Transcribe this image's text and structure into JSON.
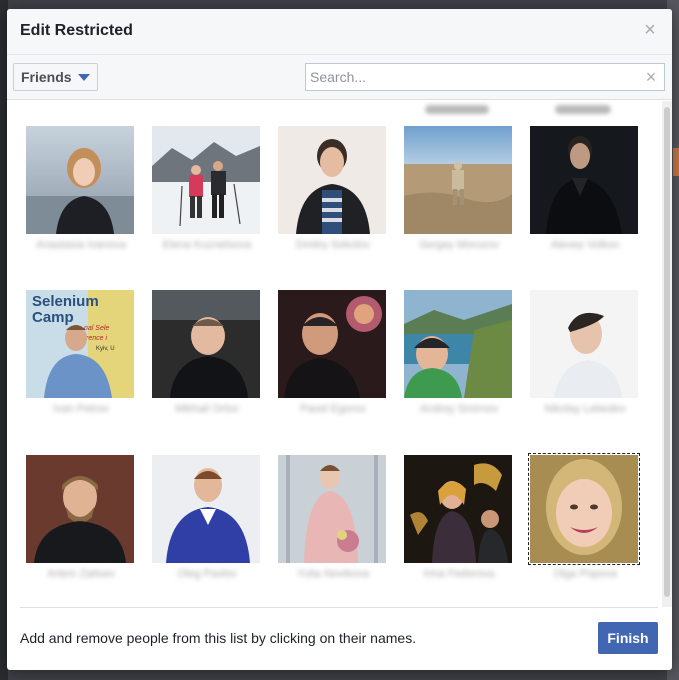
{
  "dialog": {
    "title": "Edit Restricted",
    "close_glyph": "×"
  },
  "toolbar": {
    "filter_label": "Friends",
    "search_placeholder": "Search...",
    "search_value": "",
    "clear_glyph": "×"
  },
  "friends": [
    {
      "name": "Anastasia Ivanova",
      "photo": "woman-by-sea-portrait"
    },
    {
      "name": "Elena Kuznetsova",
      "photo": "skiers-on-snow"
    },
    {
      "name": "Dmitry Sokolov",
      "photo": "man-striped-shirt"
    },
    {
      "name": "Sergey Morozov",
      "photo": "person-in-desert"
    },
    {
      "name": "Alexey Volkov",
      "photo": "man-dark-background"
    },
    {
      "name": "Ivan Petrov",
      "photo": "speaker-at-selenium-camp"
    },
    {
      "name": "Mikhail Orlov",
      "photo": "man-in-car-selfie"
    },
    {
      "name": "Pavel Egorov",
      "photo": "man-with-lamp"
    },
    {
      "name": "Andrey Smirnov",
      "photo": "man-cap-mountains"
    },
    {
      "name": "Nikolay Lebedev",
      "photo": "man-profile-studio"
    },
    {
      "name": "Artem Zaitsev",
      "photo": "bearded-man-dark-jacket"
    },
    {
      "name": "Oleg Pavlov",
      "photo": "man-blue-blazer"
    },
    {
      "name": "Yulia Novikova",
      "photo": "woman-with-bouquet"
    },
    {
      "name": "Irina Fedorova",
      "photo": "singer-with-orchestra"
    },
    {
      "name": "Olga Popova",
      "photo": "blonde-woman-smiling",
      "selected": true
    }
  ],
  "footer": {
    "hint": "Add and remove people from this list by clicking on their names.",
    "finish_label": "Finish"
  },
  "colors": {
    "brand_blue": "#4267b2",
    "header_bg": "#f6f7f9",
    "text_dark": "#1d2129"
  }
}
